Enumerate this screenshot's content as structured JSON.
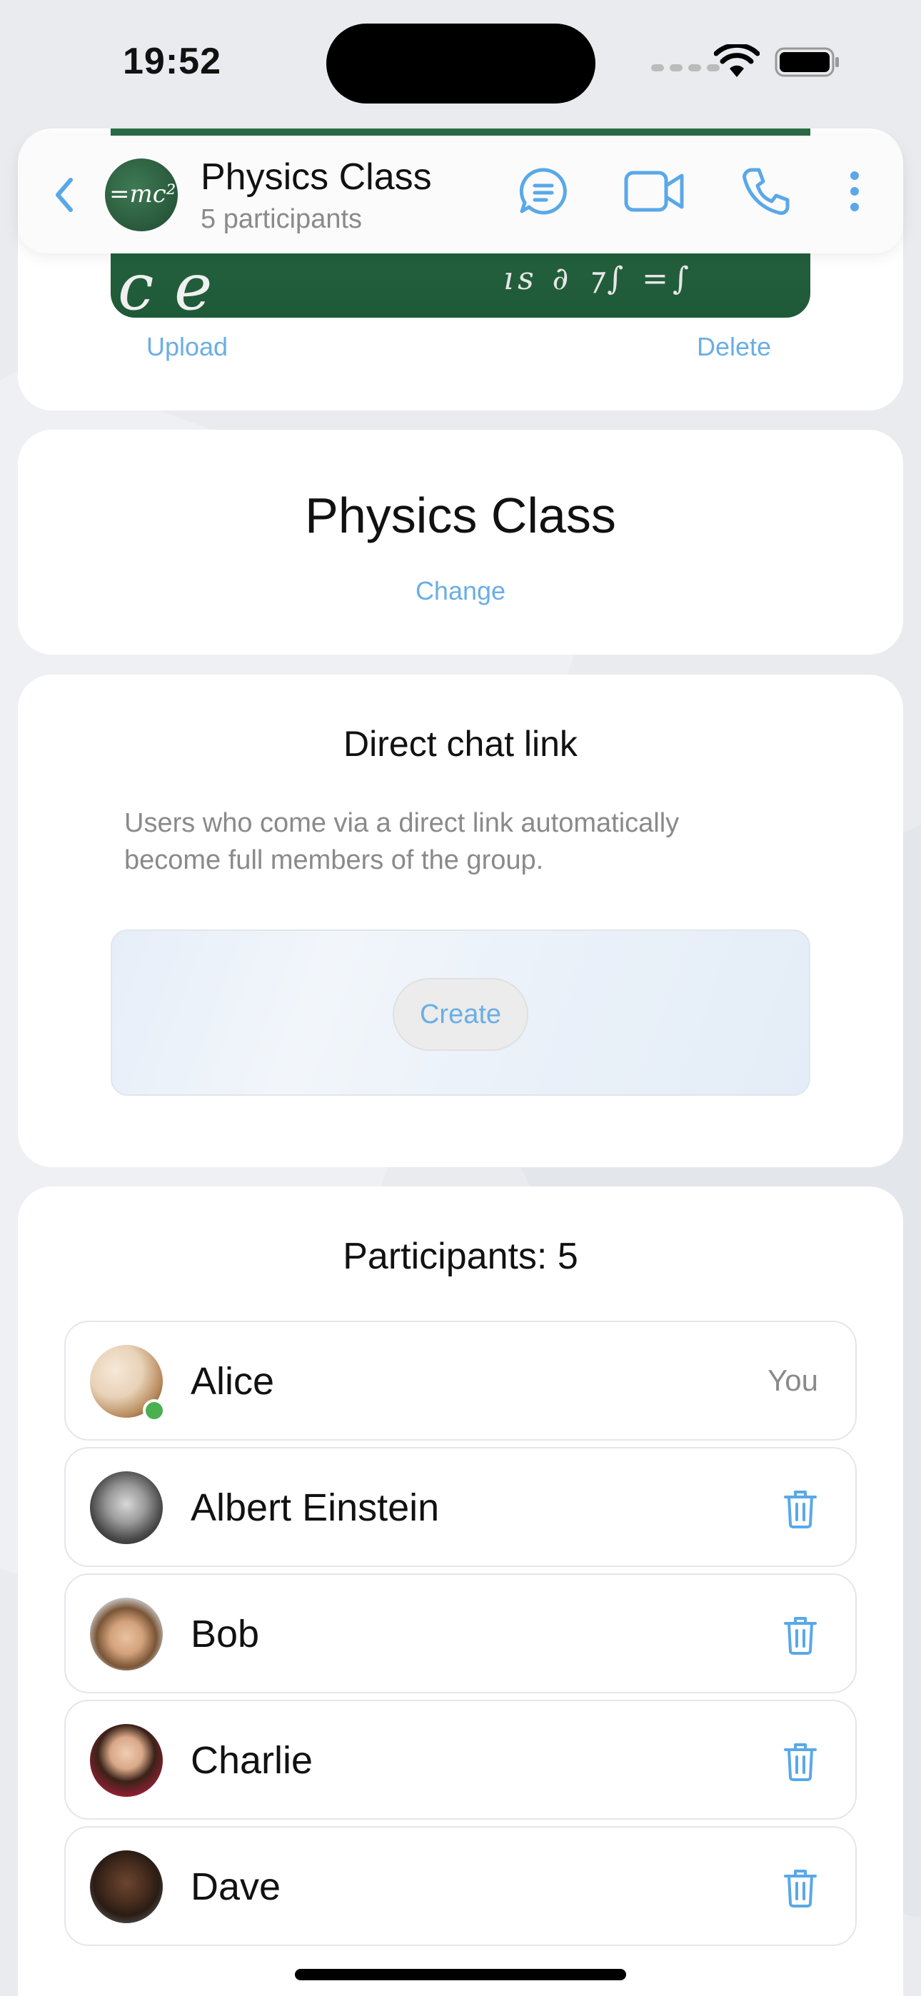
{
  "status_bar": {
    "time": "19:52"
  },
  "header": {
    "title": "Physics Class",
    "subtitle": "5 participants",
    "avatar_text": "=mc²"
  },
  "photo": {
    "upload_label": "Upload",
    "delete_label": "Delete"
  },
  "group": {
    "name": "Physics Class",
    "change_label": "Change"
  },
  "direct_link": {
    "title": "Direct chat link",
    "description": "Users who come via a direct link automatically become full members of the group.",
    "create_label": "Create"
  },
  "participants": {
    "title": "Participants: 5",
    "items": [
      {
        "name": "Alice",
        "badge": "You",
        "online": true
      },
      {
        "name": "Albert Einstein"
      },
      {
        "name": "Bob"
      },
      {
        "name": "Charlie"
      },
      {
        "name": "Dave"
      }
    ]
  },
  "colors": {
    "accent": "#5aa8e8",
    "online": "#4caf50",
    "secondary_text": "#8a8a8a"
  },
  "icons": [
    "back-chevron-icon",
    "chat-bubble-icon",
    "video-camera-icon",
    "phone-icon",
    "more-vertical-icon",
    "trash-icon"
  ]
}
